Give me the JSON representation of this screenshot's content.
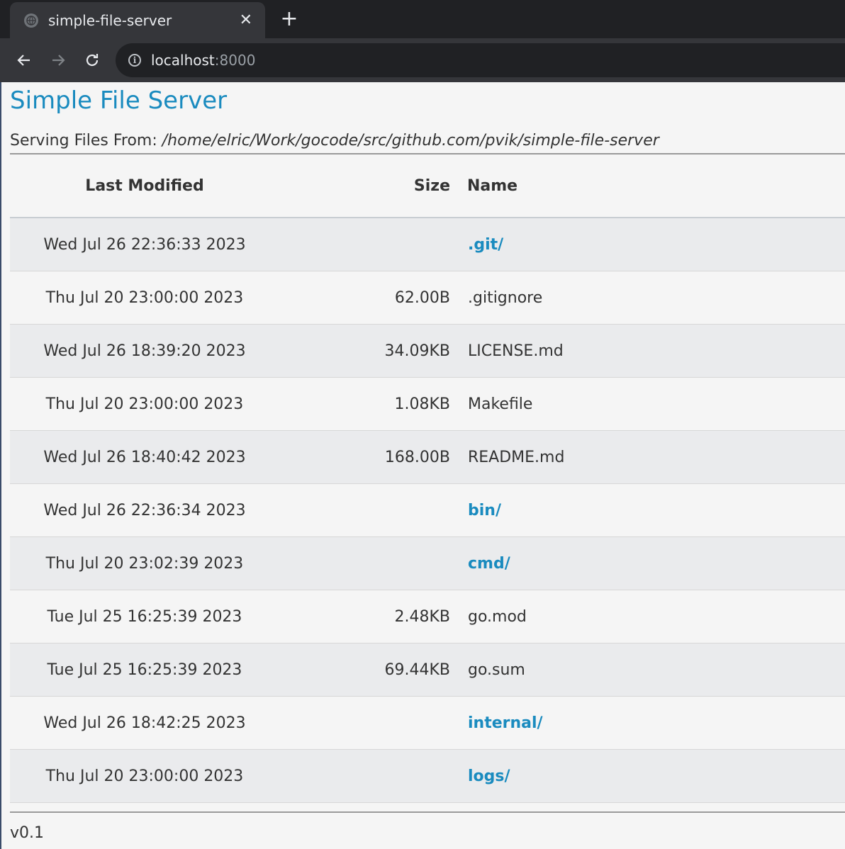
{
  "browser": {
    "tab_title": "simple-file-server",
    "url_host": "localhost",
    "url_port": ":8000"
  },
  "page": {
    "title": "Simple File Server",
    "serving_label": "Serving Files From:",
    "serving_path": "/home/elric/Work/gocode/src/github.com/pvik/simple-file-server",
    "columns": {
      "modified": "Last Modified",
      "size": "Size",
      "name": "Name"
    },
    "rows": [
      {
        "modified": "Wed Jul 26 22:36:33 2023",
        "size": "",
        "name": ".git/"
      },
      {
        "modified": "Thu Jul 20 23:00:00 2023",
        "size": "62.00B",
        "name": ".gitignore"
      },
      {
        "modified": "Wed Jul 26 18:39:20 2023",
        "size": "34.09KB",
        "name": "LICENSE.md"
      },
      {
        "modified": "Thu Jul 20 23:00:00 2023",
        "size": "1.08KB",
        "name": "Makefile"
      },
      {
        "modified": "Wed Jul 26 18:40:42 2023",
        "size": "168.00B",
        "name": "README.md"
      },
      {
        "modified": "Wed Jul 26 22:36:34 2023",
        "size": "",
        "name": "bin/"
      },
      {
        "modified": "Thu Jul 20 23:02:39 2023",
        "size": "",
        "name": "cmd/"
      },
      {
        "modified": "Tue Jul 25 16:25:39 2023",
        "size": "2.48KB",
        "name": "go.mod"
      },
      {
        "modified": "Tue Jul 25 16:25:39 2023",
        "size": "69.44KB",
        "name": "go.sum"
      },
      {
        "modified": "Wed Jul 26 18:42:25 2023",
        "size": "",
        "name": "internal/"
      },
      {
        "modified": "Thu Jul 20 23:00:00 2023",
        "size": "",
        "name": "logs/"
      }
    ],
    "version": "v0.1"
  },
  "colors": {
    "link": "#1a8bbf",
    "row_alt": "#eaebed",
    "chrome_dark": "#202124",
    "chrome_toolbar": "#35363a"
  }
}
